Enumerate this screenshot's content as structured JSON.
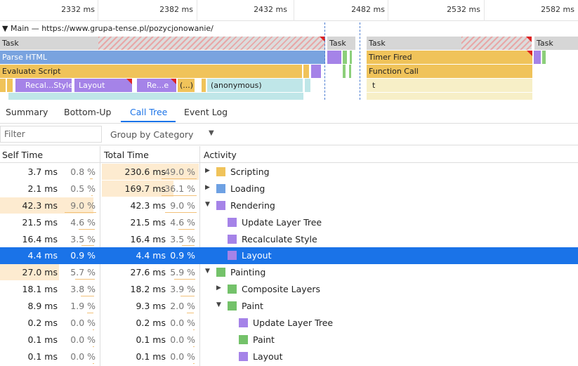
{
  "ruler": {
    "ticks": [
      "2332 ms",
      "2382 ms",
      "2432 ms",
      "2482 ms",
      "2532 ms",
      "2582 ms"
    ]
  },
  "flame": {
    "main_title": "▼ Main — https://www.grupa-tense.pl/pozycjonowanie/",
    "task_label": "Task",
    "parse_html": "Parse HTML",
    "evaluate_script": "Evaluate Script",
    "timer_fired": "Timer Fired",
    "function_call": "Function Call",
    "recalc_style": "Recal...Style",
    "layout": "Layout",
    "re_e": "Re...e",
    "anon_short": "(...)",
    "anonymous": "(anonymous)",
    "t_label": "t"
  },
  "tabs": [
    {
      "label": "Summary"
    },
    {
      "label": "Bottom-Up"
    },
    {
      "label": "Call Tree"
    },
    {
      "label": "Event Log"
    }
  ],
  "active_tab": "Call Tree",
  "filter": {
    "placeholder": "Filter",
    "group_by": "Group by Category"
  },
  "columns": {
    "self_time": "Self Time",
    "total_time": "Total Time",
    "activity": "Activity"
  },
  "colors": {
    "scripting": "#f0c35a",
    "loading": "#6ea1e3",
    "rendering": "#a583e8",
    "painting": "#74c26a",
    "selected": "#1a73e8"
  },
  "rows": [
    {
      "self": "3.7 ms",
      "self_pct": "0.8 %",
      "total": "230.6 ms",
      "total_pct": "49.0 %",
      "expander": "▶",
      "name": "Scripting",
      "category": "scripting"
    },
    {
      "self": "2.1 ms",
      "self_pct": "0.5 %",
      "total": "169.7 ms",
      "total_pct": "36.1 %",
      "expander": "▶",
      "name": "Loading",
      "category": "loading"
    },
    {
      "self": "42.3 ms",
      "self_pct": "9.0 %",
      "total": "42.3 ms",
      "total_pct": "9.0 %",
      "expander": "▼",
      "name": "Rendering",
      "category": "rendering"
    },
    {
      "self": "21.5 ms",
      "self_pct": "4.6 %",
      "total": "21.5 ms",
      "total_pct": "4.6 %",
      "expander": "",
      "name": "Update Layer Tree",
      "category": "rendering"
    },
    {
      "self": "16.4 ms",
      "self_pct": "3.5 %",
      "total": "16.4 ms",
      "total_pct": "3.5 %",
      "expander": "",
      "name": "Recalculate Style",
      "category": "rendering"
    },
    {
      "self": "4.4 ms",
      "self_pct": "0.9 %",
      "total": "4.4 ms",
      "total_pct": "0.9 %",
      "expander": "",
      "name": "Layout",
      "category": "rendering",
      "selected": true
    },
    {
      "self": "27.0 ms",
      "self_pct": "5.7 %",
      "total": "27.6 ms",
      "total_pct": "5.9 %",
      "expander": "▼",
      "name": "Painting",
      "category": "painting"
    },
    {
      "self": "18.1 ms",
      "self_pct": "3.8 %",
      "total": "18.2 ms",
      "total_pct": "3.9 %",
      "expander": "▶",
      "name": "Composite Layers",
      "category": "painting"
    },
    {
      "self": "8.9 ms",
      "self_pct": "1.9 %",
      "total": "9.3 ms",
      "total_pct": "2.0 %",
      "expander": "▼",
      "name": "Paint",
      "category": "painting"
    },
    {
      "self": "0.2 ms",
      "self_pct": "0.0 %",
      "total": "0.2 ms",
      "total_pct": "0.0 %",
      "expander": "",
      "name": "Update Layer Tree",
      "category": "rendering"
    },
    {
      "self": "0.1 ms",
      "self_pct": "0.0 %",
      "total": "0.1 ms",
      "total_pct": "0.0 %",
      "expander": "",
      "name": "Paint",
      "category": "painting"
    },
    {
      "self": "0.1 ms",
      "self_pct": "0.0 %",
      "total": "0.1 ms",
      "total_pct": "0.0 %",
      "expander": "",
      "name": "Layout",
      "category": "rendering"
    }
  ]
}
